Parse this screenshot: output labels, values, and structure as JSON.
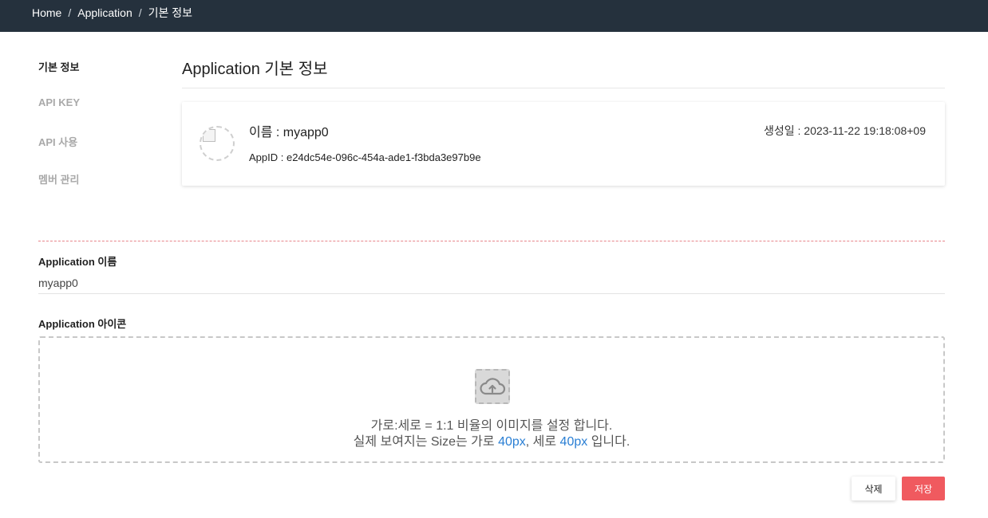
{
  "breadcrumb": {
    "home": "Home",
    "sep1": "/",
    "application": "Application",
    "sep2": "/",
    "current": "기본 정보"
  },
  "sidebar": {
    "items": [
      {
        "label": "기본 정보",
        "active": true
      },
      {
        "label": "API KEY",
        "active": false
      },
      {
        "label": "API 사용",
        "active": false
      },
      {
        "label": "멤버 관리",
        "active": false
      }
    ]
  },
  "page": {
    "title": "Application 기본 정보"
  },
  "app_card": {
    "name": "이름 : myapp0",
    "app_id": "AppID : e24dc54e-096c-454a-ade1-f3bda3e97b9e",
    "created": "생성일 : 2023-11-22 19:18:08+09"
  },
  "form": {
    "name_label": "Application 이름",
    "name_value": "myapp0",
    "icon_label": "Application 아이콘"
  },
  "dropzone": {
    "line1": "가로:세로 = 1:1 비율의 이미지를 설정 합니다.",
    "line2_prefix": "실제 보여지는 Size는 가로 ",
    "width_value": "40px",
    "line2_mid": ", 세로 ",
    "height_value": "40px",
    "line2_suffix": " 입니다.",
    "icon": "cloud-upload-icon"
  },
  "actions": {
    "delete_label": "삭제",
    "save_label": "저장"
  },
  "colors": {
    "topbar": "#25313d",
    "save_button": "#f05a5f",
    "highlight": "#2a7fd4",
    "divider_dashed": "#e8868b"
  }
}
